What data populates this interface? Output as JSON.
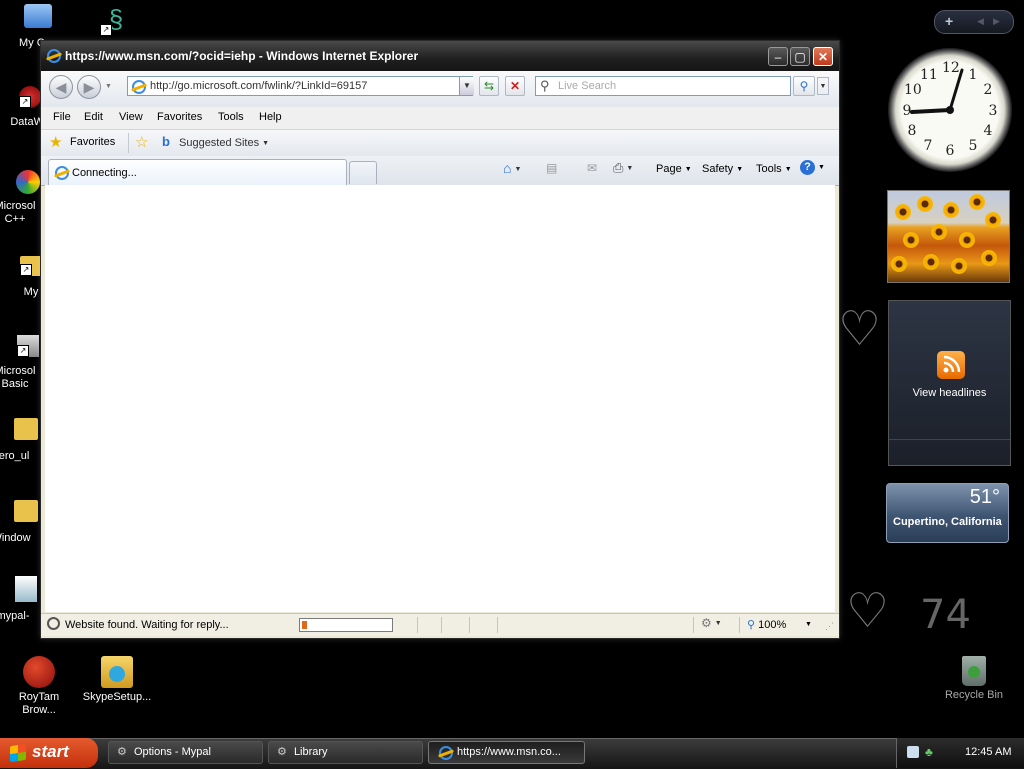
{
  "desktop": {
    "icons": [
      {
        "label": "My Con"
      },
      {
        "label": "DataWa"
      },
      {
        "label": "Microsol C++"
      },
      {
        "label": "My"
      },
      {
        "label": "Microsol Basic"
      },
      {
        "label": "aero_ul"
      },
      {
        "label": "Window"
      },
      {
        "label": "mypal-"
      },
      {
        "label": "RoyTam Brow..."
      },
      {
        "label": "SkypeSetup..."
      }
    ],
    "recycle_bin": "Recycle Bin",
    "temp_number": "74"
  },
  "ie": {
    "title": "https://www.msn.com/?ocid=iehp - Windows Internet Explorer",
    "address": "http://go.microsoft.com/fwlink/?LinkId=69157",
    "search_placeholder": "Live Search",
    "menu": [
      "File",
      "Edit",
      "View",
      "Favorites",
      "Tools",
      "Help"
    ],
    "favorites_label": "Favorites",
    "suggested_sites": "Suggested Sites",
    "tab_label": "Connecting...",
    "commands": {
      "page": "Page",
      "safety": "Safety",
      "tools": "Tools"
    },
    "status_text": "Website found. Waiting for reply...",
    "zoom": "100%",
    "progress_fraction": 0.06
  },
  "gadgets": {
    "clock_numbers": [
      "12",
      "1",
      "2",
      "3",
      "4",
      "5",
      "6",
      "7",
      "8",
      "9",
      "10",
      "11"
    ],
    "rss_label": "View headlines",
    "weather_temp": "51°",
    "weather_city": "Cupertino, California"
  },
  "taskbar": {
    "start": "start",
    "tasks": [
      "Options - Mypal",
      "Library",
      "https://www.msn.co..."
    ],
    "time": "12:45 AM"
  },
  "colors": {
    "accent": "#2a6fd6",
    "start": "#d6451a",
    "progress": "#e06a1b"
  }
}
